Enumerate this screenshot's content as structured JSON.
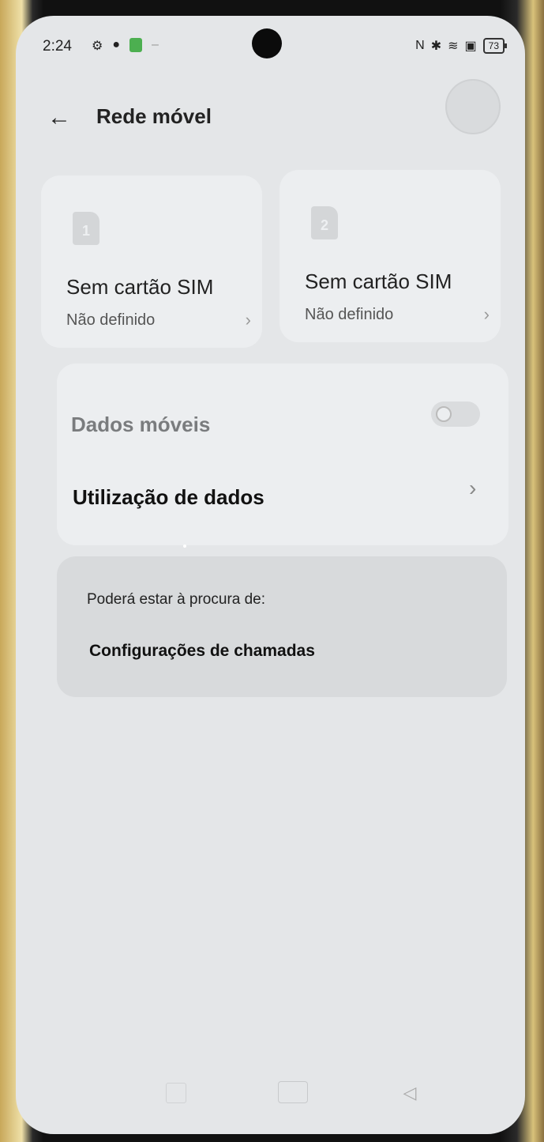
{
  "status_bar": {
    "time": "2:24",
    "left_icons": [
      "settings-icon",
      "bug-icon",
      "app-green-icon",
      "dash-icon"
    ],
    "right_icons": [
      "nfc-icon",
      "bluetooth-icon",
      "wifi-icon",
      "sim-x-icon"
    ],
    "battery": "73"
  },
  "header": {
    "back_icon": "arrow-left-icon",
    "title": "Rede móvel",
    "avatar_icon": "circle-icon"
  },
  "sim_cards": [
    {
      "number": "1",
      "label": "Sem cartão SIM",
      "status": "Não definido"
    },
    {
      "number": "2",
      "label": "Sem cartão SIM",
      "status": "Não definido"
    }
  ],
  "data_section": {
    "mobile_data_label": "Dados móveis",
    "mobile_data_enabled": false,
    "usage_label": "Utilização de dados"
  },
  "suggestions": {
    "heading": "Poderá estar à procura de:",
    "link": "Configurações de chamadas"
  },
  "nav_bar": {
    "icons": [
      "recent-apps-icon",
      "home-icon",
      "back-icon"
    ]
  }
}
